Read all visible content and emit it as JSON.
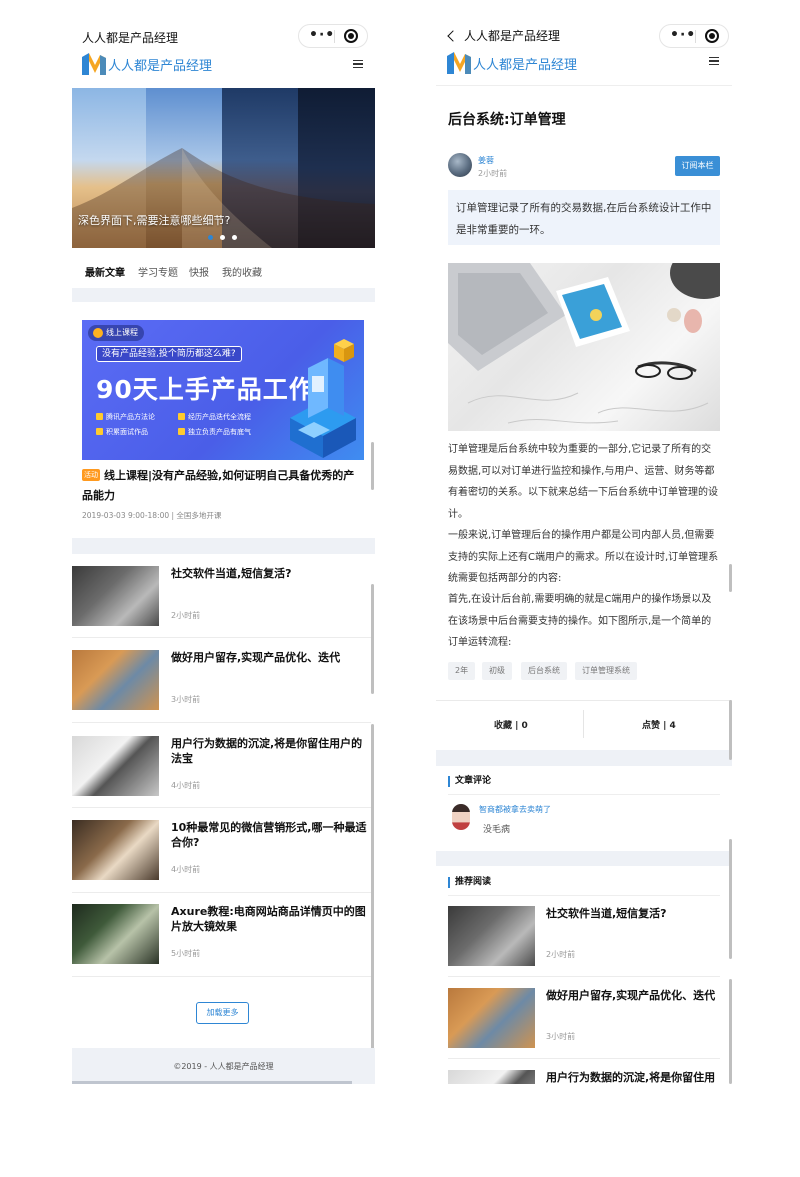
{
  "left": {
    "status_title": "人人都是产品经理",
    "logo_text": "人人都是产品经理",
    "hero": {
      "caption": "深色界面下,需要注意哪些细节?"
    },
    "tabs": [
      "最新文章",
      "学习专题",
      "快报",
      "我的收藏"
    ],
    "promo": {
      "badge": "线上课程",
      "subtitle": "没有产品经验,投个简历都这么难?",
      "main": "90天上手产品工作",
      "features": [
        "腾讯产品方法论",
        "经历产品迭代全流程",
        "积累面试作品",
        "独立负责产品有底气"
      ],
      "tag": "活动",
      "title": "线上课程|没有产品经验,如何证明自己具备优秀的产品能力",
      "meta": "2019-03-03 9:00-18:00 | 全国多地开课"
    },
    "articles": [
      {
        "title": "社交软件当道,短信复活?",
        "time": "2小时前"
      },
      {
        "title": "做好用户留存,实现产品优化、迭代",
        "time": "3小时前"
      },
      {
        "title": "用户行为数据的沉淀,将是你留住用户的法宝",
        "time": "4小时前"
      },
      {
        "title": "10种最常见的微信营销形式,哪一种最适合你?",
        "time": "4小时前"
      },
      {
        "title": "Axure教程:电商网站商品详情页中的图片放大镜效果",
        "time": "5小时前"
      }
    ],
    "load_more": "加载更多",
    "footer": "©2019 - 人人都是产品经理"
  },
  "right": {
    "status_title": "人人都是产品经理",
    "logo_text": "人人都是产品经理",
    "title": "后台系统:订单管理",
    "author": {
      "name": "姜蓉",
      "time": "2小时前"
    },
    "subscribe": "订阅本栏",
    "summary": "订单管理记录了所有的交易数据,在后台系统设计工作中是非常重要的一环。",
    "paragraphs": [
      " 订单管理是后台系统中较为重要的一部分,它记录了所有的交易数据,可以对订单进行监控和操作,与用户、运营、财务等都有着密切的关系。以下就来总结一下后台系统中订单管理的设计。",
      " 一般来说,订单管理后台的操作用户都是公司内部人员,但需要支持的实际上还有C端用户的需求。所以在设计时,订单管理系统需要包括两部分的内容:",
      " 首先,在设计后台前,需要明确的就是C端用户的操作场景以及在该场景中后台需要支持的操作。如下图所示,是一个简单的订单运转流程:"
    ],
    "tags": [
      "2年",
      "初级",
      "后台系统",
      "订单管理系统"
    ],
    "favorite": "收藏 | 0",
    "like": "点赞 | 4",
    "comments_head": "文章评论",
    "comment": {
      "name": "智商都被拿去卖萌了",
      "body": "没毛病"
    },
    "recommend_head": "推荐阅读",
    "recommend": [
      {
        "title": "社交软件当道,短信复活?",
        "time": "2小时前"
      },
      {
        "title": "做好用户留存,实现产品优化、迭代",
        "time": "3小时前"
      },
      {
        "title": "用户行为数据的沉淀,将是你留住用户的法宝",
        "time": ""
      }
    ]
  },
  "colors": {
    "accent": "#2e86d4",
    "band": "#eef1f6",
    "promo": "#5b6cf5",
    "activity_tag": "#ff9a1f"
  },
  "icons": [
    "logo-icon",
    "menu-icon",
    "more-dots-icon",
    "close-circle-icon",
    "back-icon"
  ]
}
